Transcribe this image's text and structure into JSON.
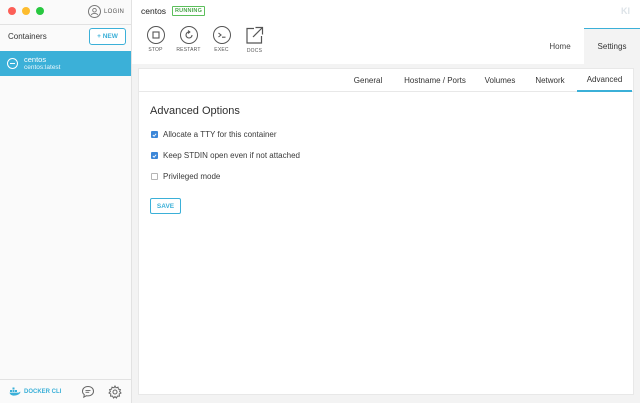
{
  "sidebar": {
    "login_label": "LOGIN",
    "containers_title": "Containers",
    "new_button": "+ NEW",
    "containers": [
      {
        "name": "centos",
        "image": "centos:latest"
      }
    ],
    "docker_cli_label": "DOCKER CLI"
  },
  "header": {
    "container_name": "centos",
    "status_badge": "RUNNING",
    "logo": "KI",
    "actions": [
      {
        "label": "STOP",
        "icon": "stop-icon"
      },
      {
        "label": "RESTART",
        "icon": "restart-icon"
      },
      {
        "label": "EXEC",
        "icon": "terminal-icon"
      },
      {
        "label": "DOCS",
        "icon": "external-link-icon"
      }
    ],
    "tabs": [
      {
        "label": "Home"
      },
      {
        "label": "Settings"
      }
    ]
  },
  "settings": {
    "subtabs": [
      {
        "label": "General"
      },
      {
        "label": "Hostname / Ports"
      },
      {
        "label": "Volumes"
      },
      {
        "label": "Network"
      },
      {
        "label": "Advanced"
      }
    ],
    "active_subtab": "Advanced",
    "advanced": {
      "title": "Advanced Options",
      "options": [
        {
          "label": "Allocate a TTY for this container",
          "checked": true
        },
        {
          "label": "Keep STDIN open even if not attached",
          "checked": true
        },
        {
          "label": "Privileged mode",
          "checked": false
        }
      ],
      "save_label": "SAVE"
    }
  },
  "colors": {
    "accent": "#3bb0d8",
    "running": "#5cbf5b",
    "checkbox": "#3b86d8"
  }
}
